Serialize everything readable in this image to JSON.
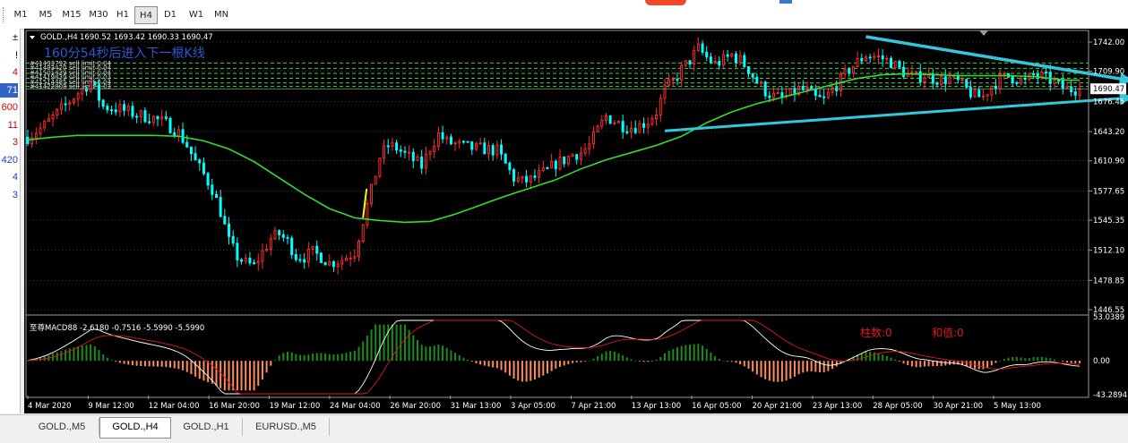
{
  "toolbar": {
    "timeframes": [
      "M1",
      "M5",
      "M15",
      "M30",
      "H1",
      "H4",
      "D1",
      "W1",
      "MN"
    ],
    "active": "H4"
  },
  "left_panel": {
    "items": [
      {
        "text": "±",
        "color": "#000000"
      },
      {
        "text": "!",
        "color": "#000000"
      },
      {
        "text": "4",
        "color": "#d00000"
      },
      {
        "text": "71",
        "color": "#ffffff",
        "selected": true
      },
      {
        "text": "600",
        "color": "#d00000"
      },
      {
        "text": "11",
        "color": "#d00000"
      },
      {
        "text": "3",
        "color": "#d00000"
      },
      {
        "text": "420",
        "color": "#1a3cc8"
      },
      {
        "text": "4",
        "color": "#1a3cc8"
      },
      {
        "text": "3",
        "color": "#1a3cc8"
      }
    ]
  },
  "header": {
    "symbol": "GOLD.,H4",
    "ohlc": "1690.52 1693.42 1690.33 1690.47",
    "countdown": "160分54秒后进入下一根K线",
    "orders": [
      "#41493792 sell limit 0.04",
      "#41493420 sell limit 0.04",
      "#41501439 sell limit 0.04",
      "#41419839 sell limit 0.03",
      "#41514485 sell limit 0.04",
      "#41422808 sell limit 0.03"
    ]
  },
  "macd": {
    "label": "至尊MACD88 -2.6180 -0.7516 -5.5990 -5.5990",
    "bar_count_label": "柱数:0",
    "sum_label": "和值:0",
    "scale": [
      "53.0389",
      "0.00",
      "-43.2894"
    ]
  },
  "colors": {
    "bull": "#ff2a2a",
    "bear": "#00ffff",
    "ma": "#32dc32",
    "grid": "#5a5a5a",
    "order_line": "#3cd23c",
    "trend": "#32c8dc",
    "hist_pos": "#1a8c1a",
    "hist_neg": "#ff8c5a",
    "countdown": "#2d5ad2",
    "red_text": "#e01818"
  },
  "chart_data": {
    "type": "candlestick",
    "symbol": "GOLD.,H4",
    "y_ticks": [
      1742.0,
      1709.9,
      1676.45,
      1643.2,
      1610.9,
      1577.65,
      1545.35,
      1512.1,
      1478.85,
      1446.55
    ],
    "y_range": [
      1446.55,
      1749.0
    ],
    "current_price": 1690.47,
    "x_labels": [
      "4 Mar 2020",
      "9 Mar 12:00",
      "12 Mar 04:00",
      "16 Mar 20:00",
      "19 Mar 12:00",
      "24 Mar 04:00",
      "26 Mar 20:00",
      "31 Mar 13:00",
      "3 Apr 05:00",
      "7 Apr 21:00",
      "13 Apr 13:00",
      "16 Apr 05:00",
      "20 Apr 21:00",
      "23 Apr 13:00",
      "28 Apr 05:00",
      "30 Apr 21:00",
      "5 May 13:00"
    ],
    "order_levels": [
      1719.0,
      1713.0,
      1707.5,
      1702.0,
      1697.0,
      1693.0
    ],
    "price_path": [
      [
        0,
        1637
      ],
      [
        4,
        1650
      ],
      [
        8,
        1668
      ],
      [
        12,
        1686
      ],
      [
        15,
        1698
      ],
      [
        18,
        1671
      ],
      [
        22,
        1668
      ],
      [
        26,
        1662
      ],
      [
        30,
        1658
      ],
      [
        33,
        1652
      ],
      [
        36,
        1642
      ],
      [
        38,
        1628
      ],
      [
        40,
        1610
      ],
      [
        42,
        1596
      ],
      [
        44,
        1580
      ],
      [
        46,
        1555
      ],
      [
        48,
        1522
      ],
      [
        50,
        1505
      ],
      [
        52,
        1498
      ],
      [
        54,
        1495
      ],
      [
        56,
        1510
      ],
      [
        58,
        1525
      ],
      [
        60,
        1530
      ],
      [
        62,
        1522
      ],
      [
        64,
        1506
      ],
      [
        66,
        1505
      ],
      [
        68,
        1510
      ],
      [
        70,
        1505
      ],
      [
        72,
        1498
      ],
      [
        75,
        1502
      ],
      [
        78,
        1510
      ],
      [
        80,
        1545
      ],
      [
        82,
        1578
      ],
      [
        84,
        1615
      ],
      [
        86,
        1628
      ],
      [
        88,
        1625
      ],
      [
        90,
        1618
      ],
      [
        92,
        1612
      ],
      [
        94,
        1605
      ],
      [
        96,
        1625
      ],
      [
        98,
        1640
      ],
      [
        100,
        1632
      ],
      [
        103,
        1628
      ],
      [
        106,
        1625
      ],
      [
        109,
        1624
      ],
      [
        112,
        1622
      ],
      [
        114,
        1607
      ],
      [
        116,
        1592
      ],
      [
        118,
        1588
      ],
      [
        120,
        1590
      ],
      [
        122,
        1595
      ],
      [
        124,
        1600
      ],
      [
        126,
        1608
      ],
      [
        128,
        1612
      ],
      [
        130,
        1618
      ],
      [
        132,
        1620
      ],
      [
        134,
        1628
      ],
      [
        136,
        1645
      ],
      [
        138,
        1660
      ],
      [
        140,
        1655
      ],
      [
        142,
        1650
      ],
      [
        144,
        1648
      ],
      [
        146,
        1650
      ],
      [
        148,
        1655
      ],
      [
        150,
        1665
      ],
      [
        152,
        1690
      ],
      [
        154,
        1698
      ],
      [
        156,
        1712
      ],
      [
        158,
        1722
      ],
      [
        160,
        1735
      ],
      [
        162,
        1725
      ],
      [
        164,
        1718
      ],
      [
        166,
        1722
      ],
      [
        168,
        1728
      ],
      [
        170,
        1722
      ],
      [
        172,
        1712
      ],
      [
        174,
        1698
      ],
      [
        176,
        1688
      ],
      [
        178,
        1682
      ],
      [
        180,
        1680
      ],
      [
        182,
        1684
      ],
      [
        184,
        1690
      ],
      [
        186,
        1688
      ],
      [
        188,
        1680
      ],
      [
        190,
        1678
      ],
      [
        192,
        1690
      ],
      [
        194,
        1700
      ],
      [
        196,
        1712
      ],
      [
        198,
        1720
      ],
      [
        200,
        1728
      ],
      [
        202,
        1726
      ],
      [
        204,
        1724
      ],
      [
        206,
        1720
      ],
      [
        208,
        1712
      ],
      [
        210,
        1706
      ],
      [
        212,
        1703
      ],
      [
        214,
        1706
      ],
      [
        216,
        1702
      ],
      [
        218,
        1700
      ],
      [
        220,
        1702
      ],
      [
        222,
        1698
      ],
      [
        224,
        1690
      ],
      [
        226,
        1682
      ],
      [
        228,
        1682
      ],
      [
        230,
        1694
      ],
      [
        232,
        1701
      ],
      [
        234,
        1704
      ],
      [
        236,
        1702
      ],
      [
        238,
        1698
      ],
      [
        240,
        1706
      ],
      [
        242,
        1704
      ],
      [
        244,
        1700
      ],
      [
        246,
        1694
      ],
      [
        248,
        1690
      ]
    ],
    "ma_path": [
      [
        0,
        1634
      ],
      [
        6,
        1637
      ],
      [
        12,
        1639
      ],
      [
        18,
        1639
      ],
      [
        24,
        1639
      ],
      [
        30,
        1639
      ],
      [
        36,
        1638
      ],
      [
        42,
        1633
      ],
      [
        48,
        1624
      ],
      [
        54,
        1610
      ],
      [
        60,
        1592
      ],
      [
        66,
        1574
      ],
      [
        72,
        1558
      ],
      [
        78,
        1548
      ],
      [
        84,
        1545
      ],
      [
        90,
        1543
      ],
      [
        96,
        1544
      ],
      [
        102,
        1552
      ],
      [
        108,
        1562
      ],
      [
        114,
        1572
      ],
      [
        120,
        1581
      ],
      [
        126,
        1590
      ],
      [
        132,
        1602
      ],
      [
        138,
        1612
      ],
      [
        144,
        1620
      ],
      [
        150,
        1628
      ],
      [
        156,
        1638
      ],
      [
        162,
        1653
      ],
      [
        168,
        1665
      ],
      [
        174,
        1674
      ],
      [
        180,
        1681
      ],
      [
        186,
        1688
      ],
      [
        192,
        1695
      ],
      [
        198,
        1702
      ],
      [
        204,
        1706
      ],
      [
        210,
        1707
      ],
      [
        216,
        1706
      ],
      [
        222,
        1705
      ],
      [
        228,
        1705
      ],
      [
        234,
        1705
      ],
      [
        240,
        1704
      ],
      [
        248,
        1700
      ]
    ],
    "trendlines": [
      {
        "from": [
          200,
          1748
        ],
        "to": [
          264,
          1699
        ]
      },
      {
        "from": [
          152,
          1644
        ],
        "to": [
          264,
          1681
        ]
      }
    ],
    "macd_range": [
      -43.2894,
      53.0389
    ]
  }
}
